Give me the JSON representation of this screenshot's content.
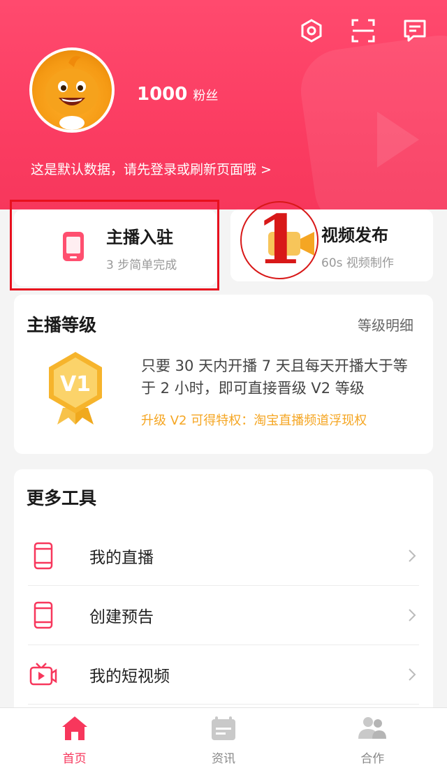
{
  "header": {
    "fans_count": "1000",
    "fans_label": "粉丝",
    "hint": "这是默认数据，请先登录或刷新页面哦 >",
    "icons": [
      "settings-icon",
      "scan-icon",
      "message-icon"
    ]
  },
  "entry": {
    "title": "主播入驻",
    "subtitle": "3 步简单完成"
  },
  "video_publish": {
    "title": "视频发布",
    "subtitle": "60s 视频制作"
  },
  "annotation": {
    "number": "1"
  },
  "level": {
    "title": "主播等级",
    "detail_link": "等级明细",
    "badge": "V1",
    "description": "只要 30 天内开播 7 天且每天开播大于等于 2 小时，即可直接晋级 V2 等级",
    "privilege": "升级 V2 可得特权：淘宝直播频道浮现权"
  },
  "tools": {
    "title": "更多工具",
    "items": [
      {
        "label": "我的直播",
        "icon": "phone-icon"
      },
      {
        "label": "创建预告",
        "icon": "phone-icon"
      },
      {
        "label": "我的短视频",
        "icon": "video-icon"
      }
    ]
  },
  "nav": {
    "items": [
      {
        "label": "首页",
        "icon": "home-icon",
        "active": true
      },
      {
        "label": "资讯",
        "icon": "news-icon",
        "active": false
      },
      {
        "label": "合作",
        "icon": "partner-icon",
        "active": false
      }
    ]
  },
  "colors": {
    "brand": "#f7375c",
    "accent_gold": "#f5a623",
    "annotation_red": "#d81818"
  }
}
